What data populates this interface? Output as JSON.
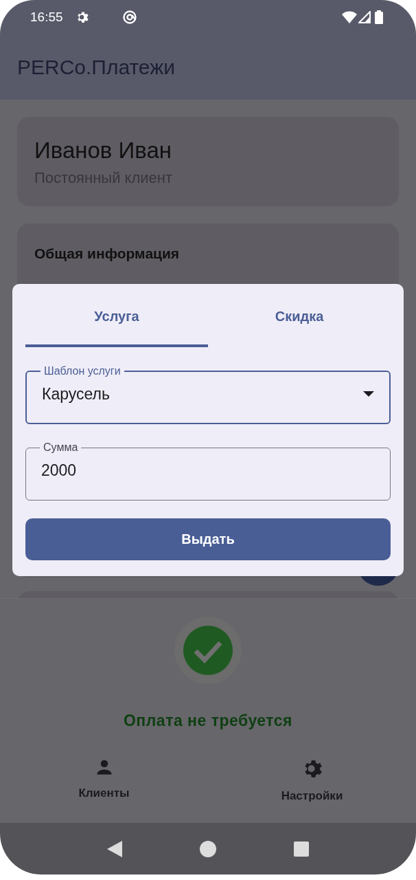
{
  "status_bar": {
    "time": "16:55"
  },
  "app_bar": {
    "title": "PERCo.Платежи"
  },
  "client_card": {
    "name": "Иванов Иван",
    "status": "Постоянный клиент"
  },
  "info_card": {
    "title": "Общая информация"
  },
  "dialog": {
    "tabs": [
      {
        "label": "Услуга",
        "selected": true
      },
      {
        "label": "Скидка",
        "selected": false
      }
    ],
    "fields": [
      {
        "kind": "dropdown",
        "label": "Шаблон услуги",
        "value": "Карусель",
        "focused": true
      },
      {
        "kind": "text",
        "label": "Сумма",
        "value": "2000",
        "focused": false
      }
    ],
    "button": "Выдать"
  },
  "payment_status": {
    "text": "Оплата не требуется"
  },
  "bottom_nav": [
    {
      "kind": "clients",
      "label": "Клиенты"
    },
    {
      "kind": "settings",
      "label": "Настройки"
    }
  ]
}
